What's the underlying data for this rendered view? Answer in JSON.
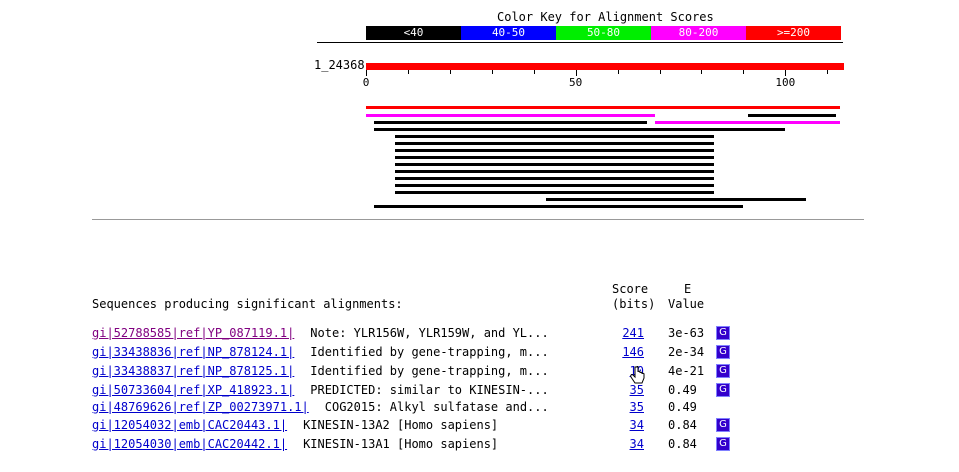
{
  "color_key": {
    "title": "Color Key for Alignment Scores",
    "segments": [
      {
        "label": "<40",
        "color": "#000000"
      },
      {
        "label": "40-50",
        "color": "#0000ff"
      },
      {
        "label": "50-80",
        "color": "#00ee00"
      },
      {
        "label": "80-200",
        "color": "#ff00ff"
      },
      {
        "label": ">=200",
        "color": "#ff0000"
      }
    ]
  },
  "query": {
    "label": "1_24368",
    "length": 114,
    "axis_labels": [
      "0",
      "50",
      "100"
    ]
  },
  "hits_graphic": [
    {
      "start": 0,
      "end": 113,
      "color": "#ff0000"
    },
    {
      "start": 0,
      "end": 69,
      "color": "#ff00ff"
    },
    {
      "start": 91,
      "end": 112,
      "color": "#000000"
    },
    {
      "start": 2,
      "end": 67,
      "color": "#000000"
    },
    {
      "start": 69,
      "end": 113,
      "color": "#ff00ff"
    },
    {
      "start": 2,
      "end": 100,
      "color": "#000000"
    },
    {
      "start": 7,
      "end": 83,
      "color": "#000000"
    },
    {
      "start": 7,
      "end": 83,
      "color": "#000000"
    },
    {
      "start": 7,
      "end": 83,
      "color": "#000000"
    },
    {
      "start": 7,
      "end": 83,
      "color": "#000000"
    },
    {
      "start": 7,
      "end": 83,
      "color": "#000000"
    },
    {
      "start": 7,
      "end": 83,
      "color": "#000000"
    },
    {
      "start": 7,
      "end": 83,
      "color": "#000000"
    },
    {
      "start": 7,
      "end": 83,
      "color": "#000000"
    },
    {
      "start": 7,
      "end": 83,
      "color": "#000000"
    },
    {
      "start": 43,
      "end": 105,
      "color": "#000000"
    },
    {
      "start": 2,
      "end": 90,
      "color": "#000000"
    }
  ],
  "results": {
    "heading": "Sequences producing significant alignments:",
    "score_header_1": "Score",
    "score_header_2": "(bits)",
    "e_header_1": "E",
    "e_header_2": "Value",
    "rows": [
      {
        "id": "gi|52788585|ref|YP_087119.1|",
        "desc": "Note: YLR156W, YLR159W, and YL...",
        "score": "241",
        "e": "3e-63",
        "g": "G",
        "visited": true
      },
      {
        "id": "gi|33438836|ref|NP_878124.1|",
        "desc": "Identified by gene-trapping, m...",
        "score": "146",
        "e": "2e-34",
        "g": "G",
        "visited": false
      },
      {
        "id": "gi|33438837|ref|NP_878125.1|",
        "desc": "Identified by gene-trapping, m...",
        "score": "10",
        "e": "4e-21",
        "g": "G",
        "visited": false
      },
      {
        "id": "gi|50733604|ref|XP_418923.1|",
        "desc": "PREDICTED: similar to KINESIN-...",
        "score": "35",
        "e": "0.49",
        "g": "G",
        "visited": false
      },
      {
        "id": "gi|48769626|ref|ZP_00273971.1|",
        "desc": "COG2015: Alkyl sulfatase and...",
        "score": "35",
        "e": "0.49",
        "g": "",
        "visited": false
      },
      {
        "id": "gi|12054032|emb|CAC20443.1|",
        "desc": "KINESIN-13A2 [Homo sapiens]",
        "score": "34",
        "e": "0.84",
        "g": "G",
        "visited": false
      },
      {
        "id": "gi|12054030|emb|CAC20442.1|",
        "desc": "KINESIN-13A1 [Homo sapiens]",
        "score": "34",
        "e": "0.84",
        "g": "G",
        "visited": false
      }
    ]
  }
}
